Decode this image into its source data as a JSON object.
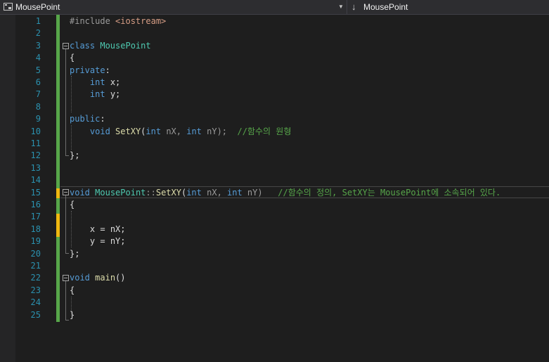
{
  "nav": {
    "scope": "MousePoint",
    "member": "MousePoint",
    "scope_dropdown_icon": "dropdown-arrow-icon",
    "member_icon": "down-arrow-icon"
  },
  "line_numbers": [
    "1",
    "2",
    "3",
    "4",
    "5",
    "6",
    "7",
    "8",
    "9",
    "10",
    "11",
    "12",
    "13",
    "14",
    "15",
    "16",
    "17",
    "18",
    "19",
    "20",
    "21",
    "22",
    "23",
    "24",
    "25"
  ],
  "code": [
    [
      {
        "t": "#include ",
        "c": "pp"
      },
      {
        "t": "<iostream>",
        "c": "s"
      }
    ],
    [],
    [
      {
        "t": "class ",
        "c": "k"
      },
      {
        "t": "MousePoint",
        "c": "t"
      }
    ],
    [
      {
        "t": "{",
        "c": "v"
      }
    ],
    [
      {
        "t": "private",
        "c": "k"
      },
      {
        "t": ":",
        "c": "v"
      }
    ],
    [
      {
        "t": "    ",
        "c": "v"
      },
      {
        "t": "int",
        "c": "k"
      },
      {
        "t": " x;",
        "c": "v"
      }
    ],
    [
      {
        "t": "    ",
        "c": "v"
      },
      {
        "t": "int",
        "c": "k"
      },
      {
        "t": " y;",
        "c": "v"
      }
    ],
    [],
    [
      {
        "t": "public",
        "c": "k"
      },
      {
        "t": ":",
        "c": "v"
      }
    ],
    [
      {
        "t": "    ",
        "c": "v"
      },
      {
        "t": "void",
        "c": "k"
      },
      {
        "t": " ",
        "c": "v"
      },
      {
        "t": "SetXY",
        "c": "f"
      },
      {
        "t": "(",
        "c": "v"
      },
      {
        "t": "int",
        "c": "k"
      },
      {
        "t": " nX, ",
        "c": "p"
      },
      {
        "t": "int",
        "c": "k"
      },
      {
        "t": " nY);  ",
        "c": "p"
      },
      {
        "t": "//함수의 원형",
        "c": "c"
      }
    ],
    [],
    [
      {
        "t": "};",
        "c": "v"
      }
    ],
    [],
    [],
    [
      {
        "t": "void",
        "c": "k"
      },
      {
        "t": " ",
        "c": "v"
      },
      {
        "t": "MousePoint",
        "c": "t"
      },
      {
        "t": "::",
        "c": "p"
      },
      {
        "t": "SetXY",
        "c": "f"
      },
      {
        "t": "(",
        "c": "v"
      },
      {
        "t": "int",
        "c": "k"
      },
      {
        "t": " nX, ",
        "c": "p"
      },
      {
        "t": "int",
        "c": "k"
      },
      {
        "t": " nY)   ",
        "c": "p"
      },
      {
        "t": "//함수의 정의, SetXY는 MousePoint에 소속되어 있다.",
        "c": "c"
      }
    ],
    [
      {
        "t": "{",
        "c": "v"
      }
    ],
    [],
    [
      {
        "t": "    ",
        "c": "v"
      },
      {
        "t": "x",
        "c": "m"
      },
      {
        "t": " = nX;",
        "c": "v"
      }
    ],
    [
      {
        "t": "    ",
        "c": "v"
      },
      {
        "t": "y",
        "c": "m"
      },
      {
        "t": " = nY;",
        "c": "v"
      }
    ],
    [
      {
        "t": "};",
        "c": "v"
      }
    ],
    [],
    [
      {
        "t": "void",
        "c": "k"
      },
      {
        "t": " ",
        "c": "v"
      },
      {
        "t": "main",
        "c": "f"
      },
      {
        "t": "()",
        "c": "v"
      }
    ],
    [
      {
        "t": "{",
        "c": "v"
      }
    ],
    [],
    [
      {
        "t": "}",
        "c": "v"
      }
    ]
  ]
}
